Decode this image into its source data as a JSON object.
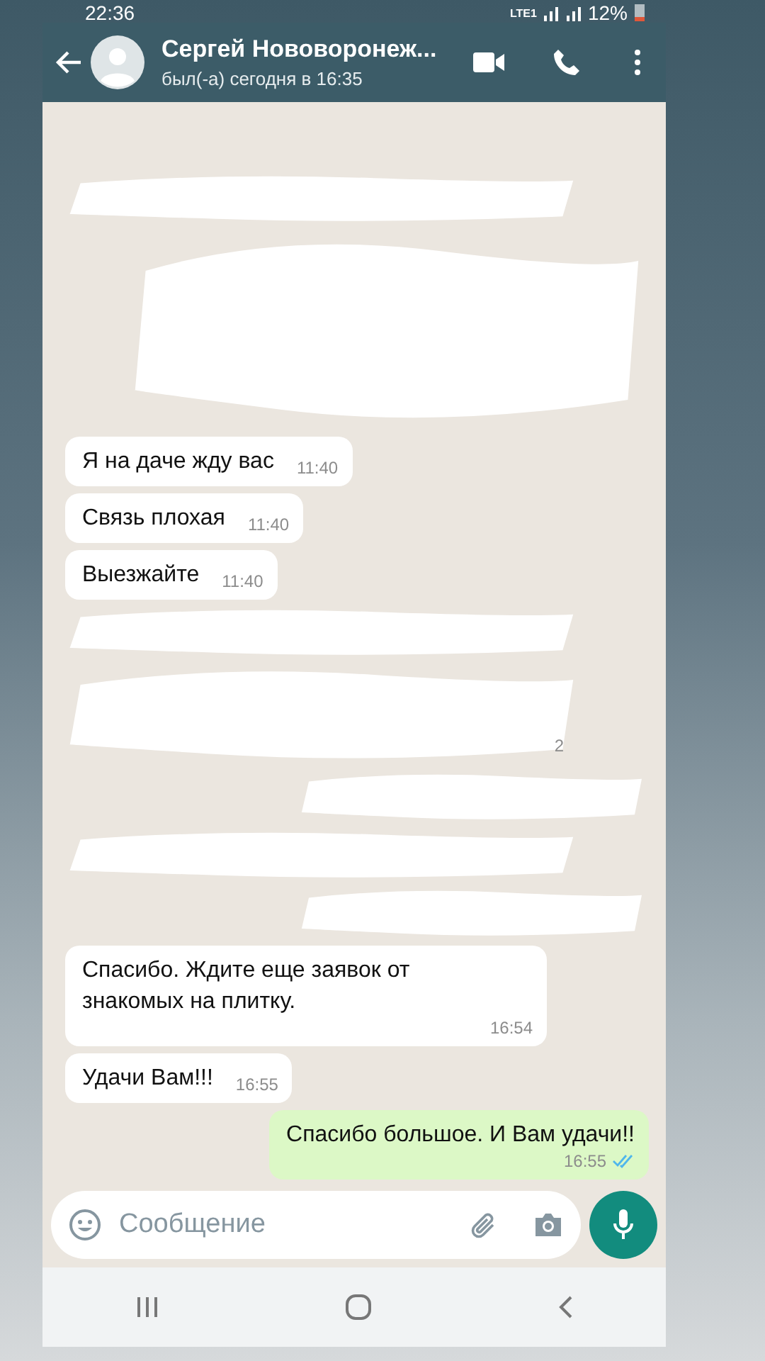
{
  "status_bar": {
    "time": "22:36",
    "network": "LTE1",
    "battery": "12%"
  },
  "header": {
    "title": "Сергей Нововоронеж...",
    "subtitle": "был(-а) сегодня в 16:35"
  },
  "messages": [
    {
      "kind": "redacted_short",
      "outgoing": false
    },
    {
      "kind": "redacted_tall",
      "outgoing": true
    },
    {
      "kind": "text",
      "outgoing": false,
      "text": "Я на даче жду вас",
      "time": "11:40"
    },
    {
      "kind": "text",
      "outgoing": false,
      "text": "Связь плохая",
      "time": "11:40"
    },
    {
      "kind": "text",
      "outgoing": false,
      "text": "Выезжайте",
      "time": "11:40"
    },
    {
      "kind": "redacted_short",
      "outgoing": false
    },
    {
      "kind": "redacted_tall",
      "outgoing": false,
      "time": "2"
    },
    {
      "kind": "redacted_short",
      "outgoing": true
    },
    {
      "kind": "redacted_short",
      "outgoing": false
    },
    {
      "kind": "redacted_short",
      "outgoing": true
    },
    {
      "kind": "text",
      "outgoing": false,
      "text": "Спасибо. Ждите еще заявок от знакомых на плитку.",
      "time": "16:54"
    },
    {
      "kind": "text",
      "outgoing": false,
      "text": "Удачи Вам!!!",
      "time": "16:55"
    },
    {
      "kind": "text",
      "outgoing": true,
      "text": "Спасибо большое. И Вам удачи!!",
      "time": "16:55",
      "read": true
    }
  ],
  "composer": {
    "placeholder": "Сообщение"
  }
}
